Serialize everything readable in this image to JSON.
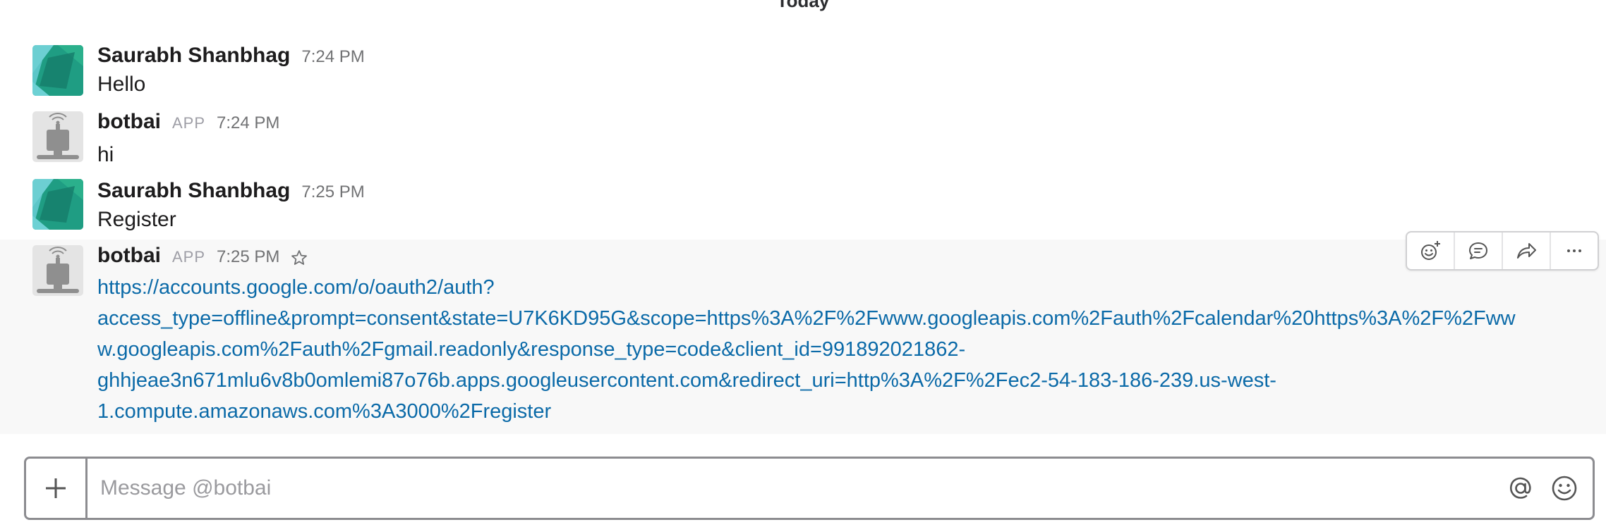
{
  "day_divider": "Today",
  "messages": [
    {
      "sender": "Saurabh Shanbhag",
      "badge": "",
      "time": "7:24 PM",
      "text": "Hello",
      "avatar": "teal-geometric-avatar"
    },
    {
      "sender": "botbai",
      "badge": "APP",
      "time": "7:24 PM",
      "text": "hi",
      "avatar": "robot-avatar"
    },
    {
      "sender": "Saurabh Shanbhag",
      "badge": "",
      "time": "7:25 PM",
      "text": "Register",
      "avatar": "teal-geometric-avatar"
    },
    {
      "sender": "botbai",
      "badge": "APP",
      "time": "7:25 PM",
      "link": "https://accounts.google.com/o/oauth2/auth?access_type=offline&prompt=consent&state=U7K6KD95G&scope=https%3A%2F%2Fwww.googleapis.com%2Fauth%2Fcalendar%20https%3A%2F%2Fwww.googleapis.com%2Fauth%2Fgmail.readonly&response_type=code&client_id=991892021862-ghhjeae3n671mlu6v8b0omlemi87o76b.apps.googleusercontent.com&redirect_uri=http%3A%2F%2Fec2-54-183-186-239.us-west-1.compute.amazonaws.com%3A3000%2Fregister",
      "link_lines": [
        "https://accounts.google.com/o/oauth2/auth?",
        "access_type=offline&prompt=consent&state=U7K6KD95G&scope=https%3A%2F%2Fwww.googleapis.com%2Fauth%2Fcalendar%20https%3A%2F%2Fww",
        "w.googleapis.com%2Fauth%2Fgmail.readonly&response_type=code&client_id=991892021862-",
        "ghhjeae3n671mlu6v8b0omlemi87o76b.apps.googleusercontent.com&redirect_uri=http%3A%2F%2Fec2-54-183-186-239.us-west-",
        "1.compute.amazonaws.com%3A3000%2Fregister"
      ],
      "avatar": "robot-avatar"
    }
  ],
  "actions": [
    "add-reaction-icon",
    "start-thread-icon",
    "share-message-icon",
    "more-actions-icon"
  ],
  "composer": {
    "placeholder": "Message @botbai"
  },
  "colors": {
    "link": "#0b6aa8",
    "hover_bg": "#f8f8f8",
    "muted": "#717274",
    "avatar_teal": "#1d9a7e"
  }
}
